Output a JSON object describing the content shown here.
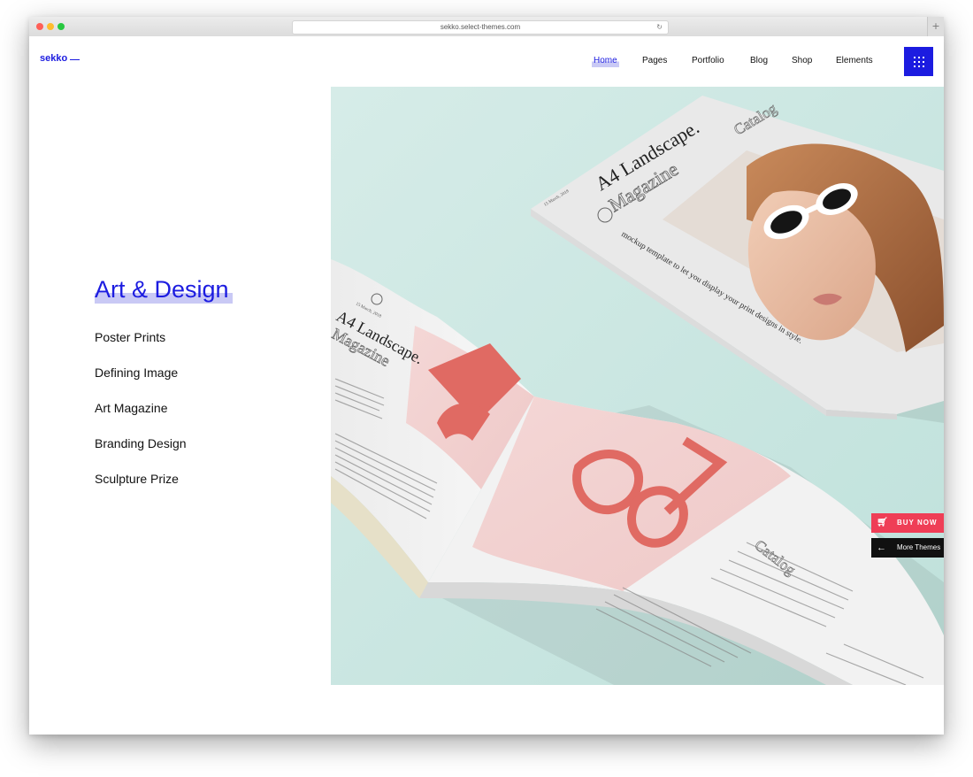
{
  "browser": {
    "url": "sekko.select-themes.com"
  },
  "header": {
    "logo": "sekko",
    "nav": [
      "Home",
      "Pages",
      "Portfolio",
      "Blog",
      "Shop",
      "Elements"
    ],
    "active_nav": "Home",
    "menu_icon": "grid-menu-icon"
  },
  "sidebar": {
    "title": "Art & Design",
    "items": [
      "Poster Prints",
      "Defining Image",
      "Art Magazine",
      "Branding Design",
      "Sculpture Prize"
    ]
  },
  "hero": {
    "magazine_right": {
      "title_line1": "A4 Landscape.",
      "title_line2": "Magazine",
      "catalog": "Catalog",
      "tagline": "mockup template to let you display your print designs in style.",
      "date": "15 March, 2018"
    },
    "magazine_left": {
      "title_line1": "A4 Landscape.",
      "title_line2": "Magazine",
      "date": "15 March, 2018",
      "catalog": "Catalog"
    }
  },
  "floating": {
    "buy_now": "BUY NOW",
    "more_themes": "More Themes"
  },
  "colors": {
    "brand": "#1c1ce0",
    "buy_now": "#ef3e56",
    "hero_bg": "#cfe9e4"
  }
}
